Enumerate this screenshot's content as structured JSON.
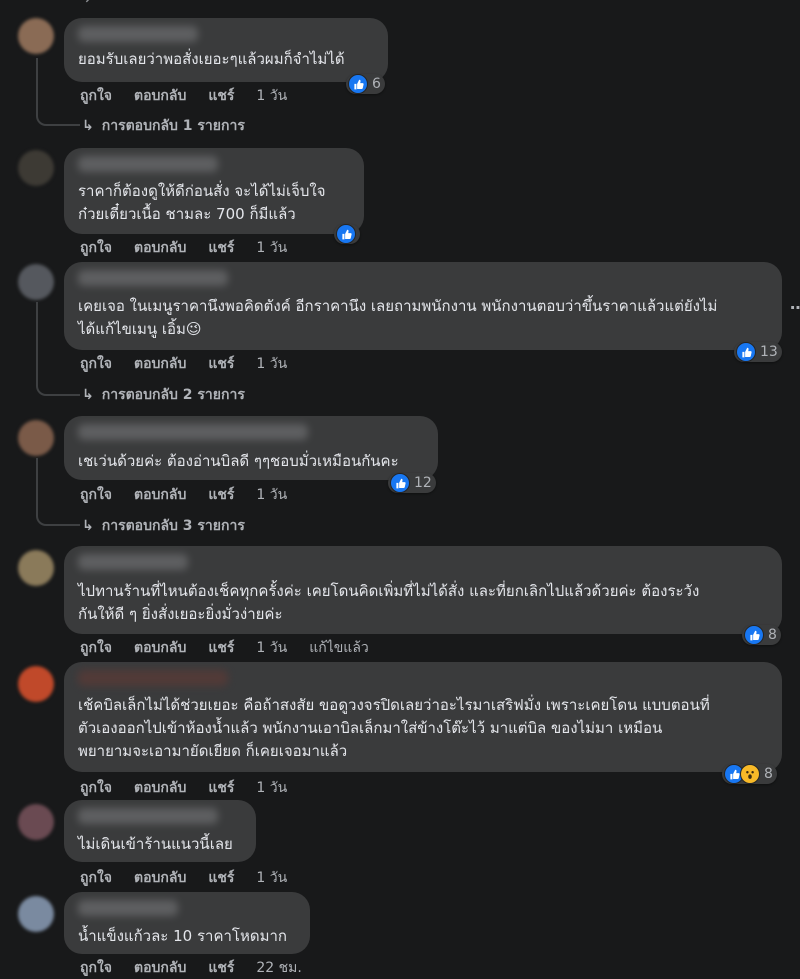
{
  "actions": {
    "like": "ถูกใจ",
    "reply": "ตอบกลับ",
    "share": "แชร์"
  },
  "comments": [
    {
      "text": "ยอมรับเลยว่าพอสั่งเยอะๆแล้วผมก็จำไม่ได้",
      "reactions": "6",
      "time": "1 วัน",
      "replies": "การตอบกลับ 1 รายการ"
    },
    {
      "text": "ราคาก็ต้องดูให้ดีก่อนสั่ง จะได้ไม่เจ็บใจ\nก๋วยเตี๋ยวเนื้อ ชามละ 700 ก็มีแล้ว",
      "time": "1 วัน"
    },
    {
      "text": "เคยเจอ ในเมนูราคานึงพอคิดตังค์ อีกราคานึง เลยถามพนักงาน พนักงานตอบว่าขึ้นราคาแล้วแต่ยังไม่\nได้แก้ไขเมนู เอิ้ม😉",
      "reactions": "13",
      "time": "1 วัน",
      "replies": "การตอบกลับ 2 รายการ"
    },
    {
      "text": "เชเว่นด้วยค่ะ ต้องอ่านบิลดี ๆๆชอบมั่วเหมือนกันคะ",
      "reactions": "12",
      "time": "1 วัน",
      "replies": "การตอบกลับ 3 รายการ"
    },
    {
      "text": "ไปทานร้านที่ไหนต้องเช็คทุกครั้งค่ะ เคยโดนคิดเพิ่มที่ไม่ได้สั่ง และที่ยกเลิกไปแล้วด้วยค่ะ ต้องระวัง\nกันให้ดี ๆ ยิ่งสั่งเยอะยิ่งมั่วง่ายค่ะ",
      "reactions": "8",
      "time": "1 วัน",
      "edited": "แก้ไขแล้ว"
    },
    {
      "text": "เช้คบิลเล็กไม่ได้ช่วยเยอะ คือถ้าสงสัย ขอดูวงจรปิดเลยว่าอะไรมาเสริฟมั่ง เพราะเคยโดน แบบตอนที่\nตัวเองออกไปเข้าห้องน้ำแล้ว พนักงานเอาบิลเล็กมาใส่ข้างโต๊ะไว้ มาแต่บิล ของไม่มา เหมือน\nพยายามจะเอามายัดเยียด ก็เคยเจอมาแล้ว",
      "reactions": "8",
      "time": "1 วัน"
    },
    {
      "text": "ไม่เดินเข้าร้านแนวนี้เลย",
      "time": "1 วัน"
    },
    {
      "text": "น้ำแข็งแก้วละ 10 ราคาโหดมาก",
      "time": "22 ชม."
    }
  ],
  "icons": {
    "like": "like-icon",
    "wow": "wow-icon",
    "reply_arrow": "reply-arrow-icon",
    "more": "more-icon"
  },
  "colors": {
    "background": "#18191a",
    "bubble": "#3a3b3c",
    "like_blue": "#1877f2",
    "meta_text": "#b0b3b8"
  }
}
